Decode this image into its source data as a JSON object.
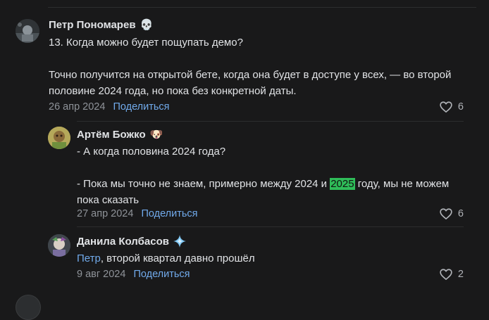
{
  "comments": [
    {
      "author": "Петр Пономарев",
      "badge_icon": "skull-icon",
      "text_line1": "13. Когда можно будет пощупать демо?",
      "text_para2": "Точно получится на открытой бете, когда она будет в доступе у всех, — во второй половине 2024 года, но пока без конкретной даты.",
      "date": "26 апр 2024",
      "share_label": "Поделиться",
      "likes": "6"
    },
    {
      "author": "Артём Божко",
      "badge_icon": "dog-icon",
      "text_line1": "- А когда половина 2024 года?",
      "text_para2_before": "- Пока мы точно не знаем, примерно между 2024 и ",
      "text_para2_highlight": "2025",
      "text_para2_after": " году, мы не можем пока сказать",
      "date": "27 апр 2024",
      "share_label": "Поделиться",
      "likes": "6"
    },
    {
      "author": "Данила Колбасов",
      "badge_icon": "sparkle-icon",
      "mention": "Петр",
      "text_after_mention": ", второй квартал давно прошёл",
      "date": "9 авг 2024",
      "share_label": "Поделиться",
      "likes": "2"
    }
  ],
  "colors": {
    "background": "#19191a",
    "link": "#71aaeb",
    "highlight": "#2fbd59"
  }
}
